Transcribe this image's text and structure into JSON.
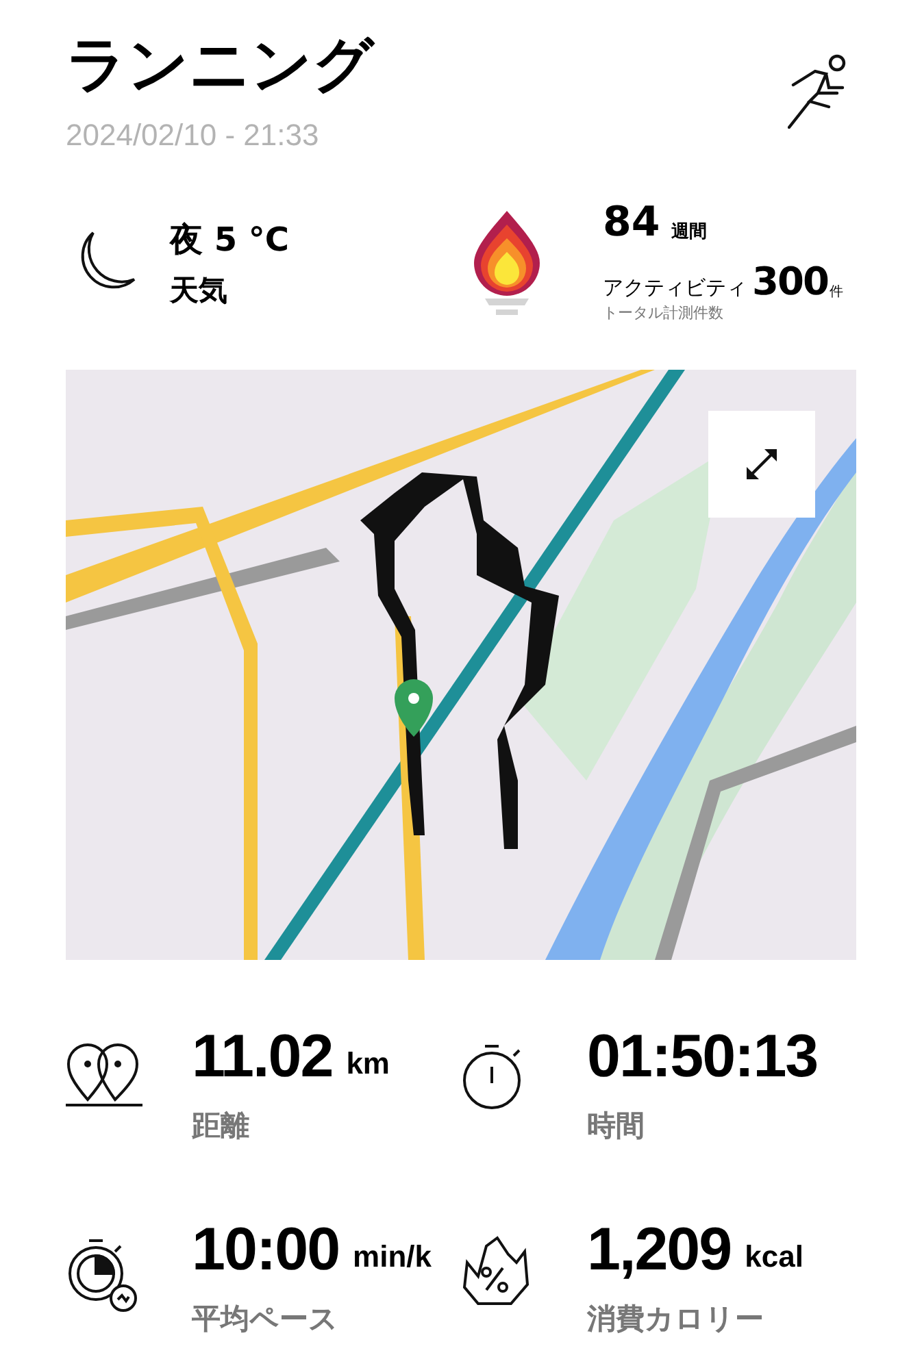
{
  "header": {
    "title": "ランニング",
    "datetime": "2024/02/10 - 21:33"
  },
  "weather": {
    "condition": "夜 5 °C",
    "label": "天気"
  },
  "activity": {
    "weeks": "84",
    "weeks_unit": "週間",
    "label": "アクティビティ",
    "count": "300",
    "count_unit": "件",
    "caption": "トータル計測件数"
  },
  "stats": [
    {
      "kind": "distance",
      "value": "11.02",
      "unit": "km",
      "label": "距離"
    },
    {
      "kind": "time",
      "value": "01:50:13",
      "label": "時間"
    },
    {
      "kind": "pace",
      "value": "10:00",
      "unit": "min/k",
      "label": "平均ペース"
    },
    {
      "kind": "calories",
      "value": "1,209",
      "unit": "kcal",
      "label": "消費カロリー"
    }
  ]
}
